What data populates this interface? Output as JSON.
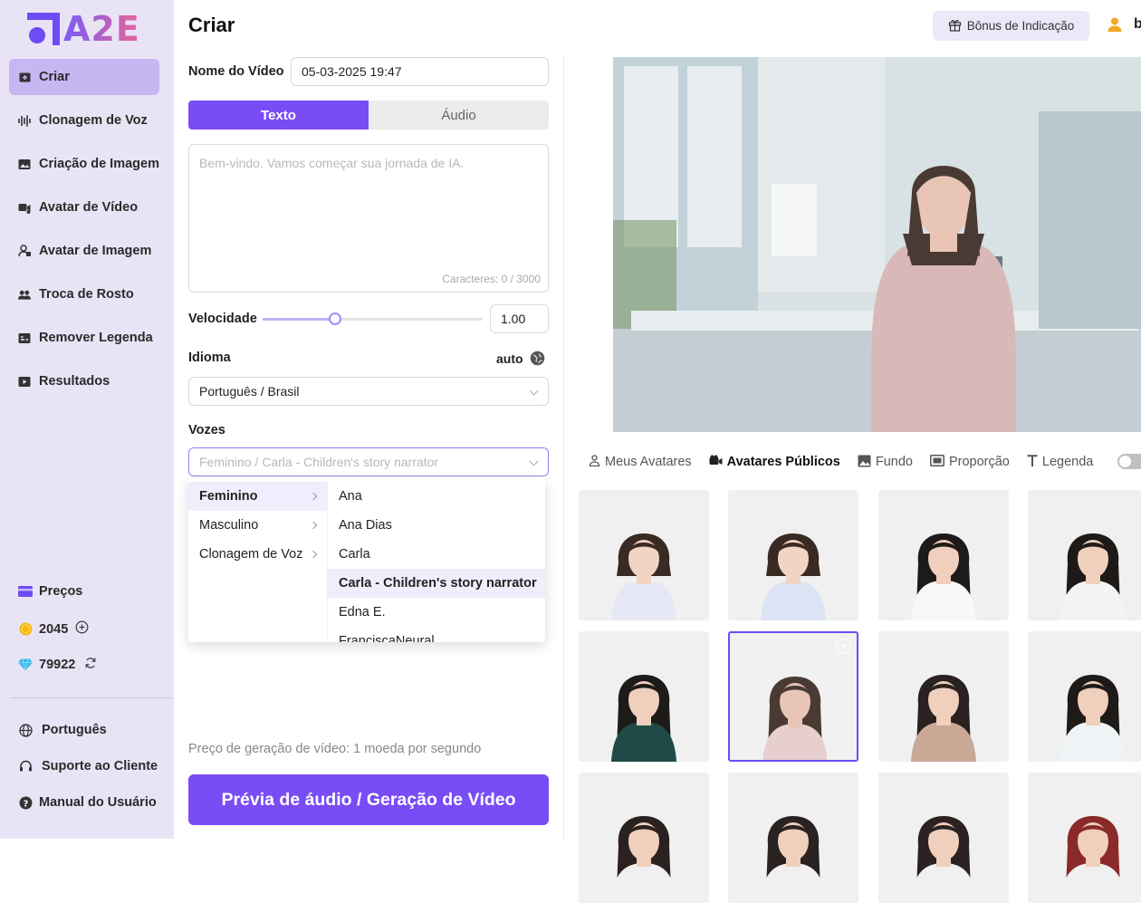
{
  "logo": {
    "text": "A2E"
  },
  "sidebar": {
    "items": [
      {
        "label": "Criar",
        "icon": "create-icon"
      },
      {
        "label": "Clonagem de Voz",
        "icon": "voice-wave-icon"
      },
      {
        "label": "Criação de Imagem",
        "icon": "image-icon"
      },
      {
        "label": "Avatar de Vídeo",
        "icon": "video-avatar-icon"
      },
      {
        "label": "Avatar de Imagem",
        "icon": "image-avatar-icon"
      },
      {
        "label": "Troca de Rosto",
        "icon": "face-swap-icon"
      },
      {
        "label": "Remover Legenda",
        "icon": "remove-caption-icon"
      },
      {
        "label": "Resultados",
        "icon": "results-icon"
      }
    ],
    "prices_label": "Preços",
    "coins": "2045",
    "diamonds": "79922",
    "language": "Português",
    "support": "Suporte ao Cliente",
    "manual": "Manual do Usuário"
  },
  "header": {
    "title": "Criar",
    "bonus_label": "Bônus de Indicação",
    "user_initial": "b"
  },
  "form": {
    "video_name_label": "Nome do Vídeo",
    "video_name_value": "05-03-2025 19:47",
    "mode_tabs": [
      "Texto",
      "Áudio"
    ],
    "text_placeholder": "Bem-vindo. Vamos começar sua jornada de IA.",
    "char_count": "Caracteres: 0 / 3000",
    "speed_label": "Velocidade",
    "speed_value": "1.00",
    "speed_fraction": 0.33,
    "language_label": "Idioma",
    "language_auto": "auto",
    "language_value": "Português / Brasil",
    "voices_label": "Vozes",
    "voices_placeholder": "Feminino / Carla - Children's story narrator",
    "price_note": "Preço de geração de vídeo: 1 moeda por segundo",
    "generate_label": "Prévia de áudio / Geração de Vídeo"
  },
  "dropdown": {
    "categories": [
      "Feminino",
      "Masculino",
      "Clonagem de Voz"
    ],
    "selected_category": "Feminino",
    "voices": [
      "Ana",
      "Ana Dias",
      "Carla",
      "Carla - Children's story narrator",
      "Edna E.",
      "FranciscaNeural"
    ],
    "selected_voice": "Carla - Children's story narrator"
  },
  "avatar_tabs": [
    {
      "label": "Meus Avatares",
      "icon": "person-icon"
    },
    {
      "label": "Avatares Públicos",
      "icon": "camera-icon"
    },
    {
      "label": "Fundo",
      "icon": "image-icon"
    },
    {
      "label": "Proporção",
      "icon": "aspect-ratio-icon"
    },
    {
      "label": "Legenda",
      "icon": "text-icon"
    }
  ],
  "colors": {
    "accent": "#7a4cf5",
    "sidebar_bg": "#e9e4f5",
    "active_nav": "#c6b6f2"
  }
}
